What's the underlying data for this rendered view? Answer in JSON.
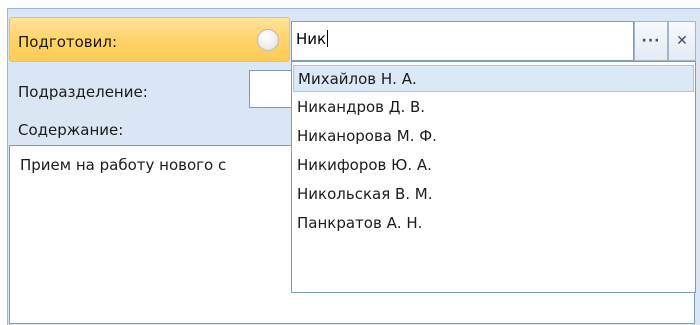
{
  "form": {
    "prepared_label": "Подготовил:",
    "department_label": "Подразделение:",
    "content_label": "Содержание:",
    "prepared_value": "Ник",
    "content_text": "Прием на работу нового с",
    "dots_button": "···",
    "clear_button": "✕"
  },
  "dropdown": {
    "items": [
      "Михайлов Н. А.",
      "Никандров Д. В.",
      "Никанорова М. Ф.",
      "Никифоров Ю. А.",
      "Никольская В. М.",
      "Панкратов А. Н."
    ],
    "selected_index": 0
  },
  "colors": {
    "highlight": "#ffd36a",
    "panel": "#dbe6f4",
    "border": "#7f9db9",
    "selection": "#dbe8f7"
  }
}
